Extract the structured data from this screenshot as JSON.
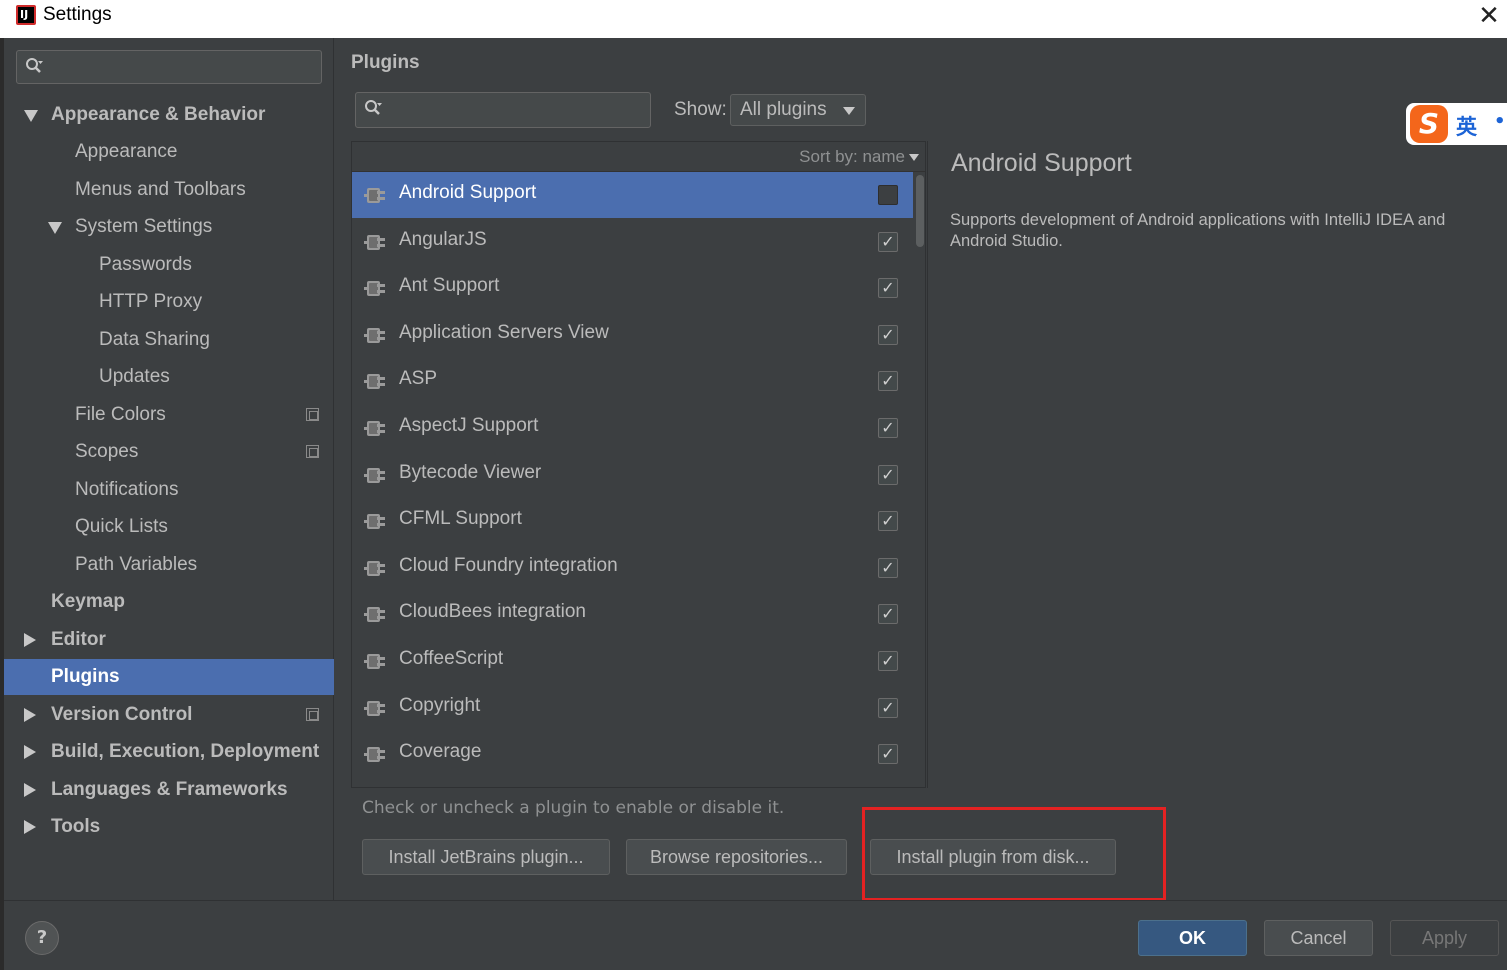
{
  "window": {
    "title": "Settings",
    "close_glyph": "✕"
  },
  "sidebar": {
    "search_placeholder": "",
    "items": [
      {
        "label": "Appearance & Behavior",
        "arrow": "down"
      },
      {
        "label": "Appearance"
      },
      {
        "label": "Menus and Toolbars"
      },
      {
        "label": "System Settings",
        "arrow": "down"
      },
      {
        "label": "Passwords"
      },
      {
        "label": "HTTP Proxy"
      },
      {
        "label": "Data Sharing"
      },
      {
        "label": "Updates"
      },
      {
        "label": "File Colors",
        "icon": "project-scope-icon"
      },
      {
        "label": "Scopes",
        "icon": "project-scope-icon"
      },
      {
        "label": "Notifications"
      },
      {
        "label": "Quick Lists"
      },
      {
        "label": "Path Variables"
      },
      {
        "label": "Keymap"
      },
      {
        "label": "Editor",
        "arrow": "right"
      },
      {
        "label": "Plugins",
        "selected": true
      },
      {
        "label": "Version Control",
        "arrow": "right",
        "icon": "project-scope-icon"
      },
      {
        "label": "Build, Execution, Deployment",
        "arrow": "right"
      },
      {
        "label": "Languages & Frameworks",
        "arrow": "right"
      },
      {
        "label": "Tools",
        "arrow": "right"
      }
    ]
  },
  "plugins": {
    "title": "Plugins",
    "search_placeholder": "",
    "show_label": "Show:",
    "show_value": "All plugins",
    "sort_label": "Sort by: name",
    "list": [
      {
        "name": "Android Support",
        "enabled": false,
        "selected": true
      },
      {
        "name": "AngularJS",
        "enabled": true
      },
      {
        "name": "Ant Support",
        "enabled": true
      },
      {
        "name": "Application Servers View",
        "enabled": true
      },
      {
        "name": "ASP",
        "enabled": true
      },
      {
        "name": "AspectJ Support",
        "enabled": true
      },
      {
        "name": "Bytecode Viewer",
        "enabled": true
      },
      {
        "name": "CFML Support",
        "enabled": true
      },
      {
        "name": "Cloud Foundry integration",
        "enabled": true
      },
      {
        "name": "CloudBees integration",
        "enabled": true
      },
      {
        "name": "CoffeeScript",
        "enabled": true
      },
      {
        "name": "Copyright",
        "enabled": true
      },
      {
        "name": "Coverage",
        "enabled": true
      }
    ],
    "check_glyph": "✓",
    "detail": {
      "title": "Android Support",
      "description": "Supports development of Android applications with IntelliJ IDEA and Android Studio."
    },
    "hint": "Check or uncheck a plugin to enable or disable it.",
    "buttons": {
      "install_jetbrains": "Install JetBrains plugin...",
      "browse_repositories": "Browse repositories...",
      "install_from_disk": "Install plugin from disk..."
    }
  },
  "footer": {
    "help": "?",
    "ok": "OK",
    "cancel": "Cancel",
    "apply": "Apply"
  },
  "ime": {
    "logo": "S",
    "mode": "英",
    "dot": "•"
  },
  "colors": {
    "background": "#3c3f41",
    "selection": "#4b6eaf",
    "highlight_box": "#e42222",
    "ok_button": "#365880"
  }
}
